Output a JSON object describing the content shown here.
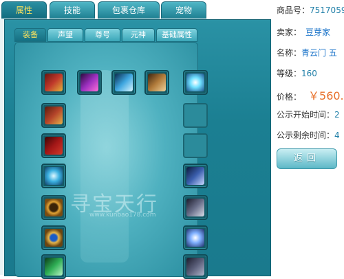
{
  "top_tabs": [
    {
      "label": "属性",
      "active": true
    },
    {
      "label": "技能",
      "active": false
    },
    {
      "label": "包裹仓库",
      "active": false
    },
    {
      "label": "宠物",
      "active": false
    }
  ],
  "sub_tabs": [
    {
      "label": "装备",
      "active": true
    },
    {
      "label": "声望",
      "active": false
    },
    {
      "label": "尊号",
      "active": false
    },
    {
      "label": "元神",
      "active": false
    },
    {
      "label": "基础属性",
      "active": false
    }
  ],
  "watermark": "寻宝天行",
  "watermark_url": "www.kunbao178.com",
  "sale_info": {
    "product_no_label": "商品号：",
    "product_no": "7517059",
    "seller_label": "卖家：",
    "seller": "豆芽家",
    "name_label": "名称：",
    "name": "青云门 五",
    "level_label": "等级：",
    "level": "160",
    "price_label": "价格：",
    "price": "￥560.",
    "public_start_label": "公示开始时间：",
    "public_start": "2",
    "public_remain_label": "公示剩余时间：",
    "public_remain": "4",
    "back_button": "返回"
  },
  "colors": {
    "price": "#e8702a",
    "link_blue": "#1a73c9",
    "active_tab_text": "#ffe45c"
  }
}
